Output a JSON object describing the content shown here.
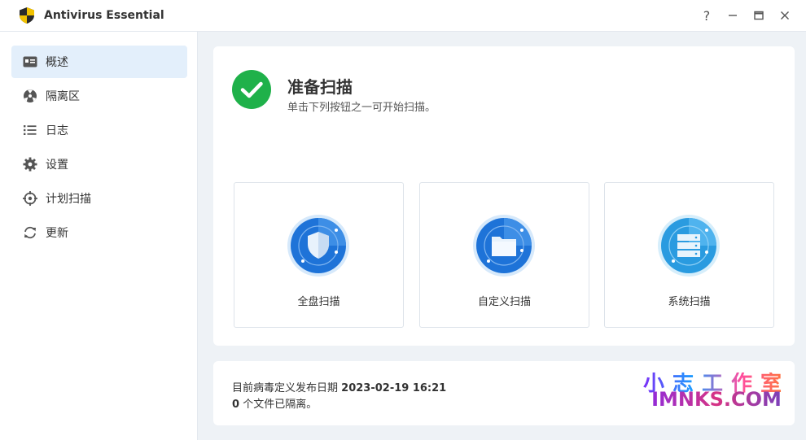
{
  "window": {
    "title": "Antivirus Essential",
    "controls": {
      "help": "?",
      "minimize": "—",
      "maximize": "▭",
      "close": "✕"
    }
  },
  "sidebar": {
    "items": [
      {
        "label": "概述",
        "icon": "overview-icon",
        "active": true
      },
      {
        "label": "隔离区",
        "icon": "quarantine-icon",
        "active": false
      },
      {
        "label": "日志",
        "icon": "list-icon",
        "active": false
      },
      {
        "label": "设置",
        "icon": "gear-icon",
        "active": false
      },
      {
        "label": "计划扫描",
        "icon": "schedule-target-icon",
        "active": false
      },
      {
        "label": "更新",
        "icon": "refresh-icon",
        "active": false
      }
    ]
  },
  "status": {
    "title": "准备扫描",
    "subtitle": "单击下列按钮之一可开始扫描。"
  },
  "scans": [
    {
      "label": "全盘扫描",
      "icon": "shield-icon"
    },
    {
      "label": "自定义扫描",
      "icon": "folder-icon"
    },
    {
      "label": "系统扫描",
      "icon": "server-icon"
    }
  ],
  "definitions": {
    "label": "目前病毒定义发布日期",
    "date": "2023-02-19 16:21",
    "quarantine_count": "0",
    "quarantine_text": "个文件已隔离。"
  },
  "watermark": {
    "cn": "小志工作室",
    "en": "IMNKS.COM"
  },
  "colors": {
    "accent": "#1e73d8",
    "success": "#1fb14a",
    "active_nav_bg": "#e3effb"
  }
}
